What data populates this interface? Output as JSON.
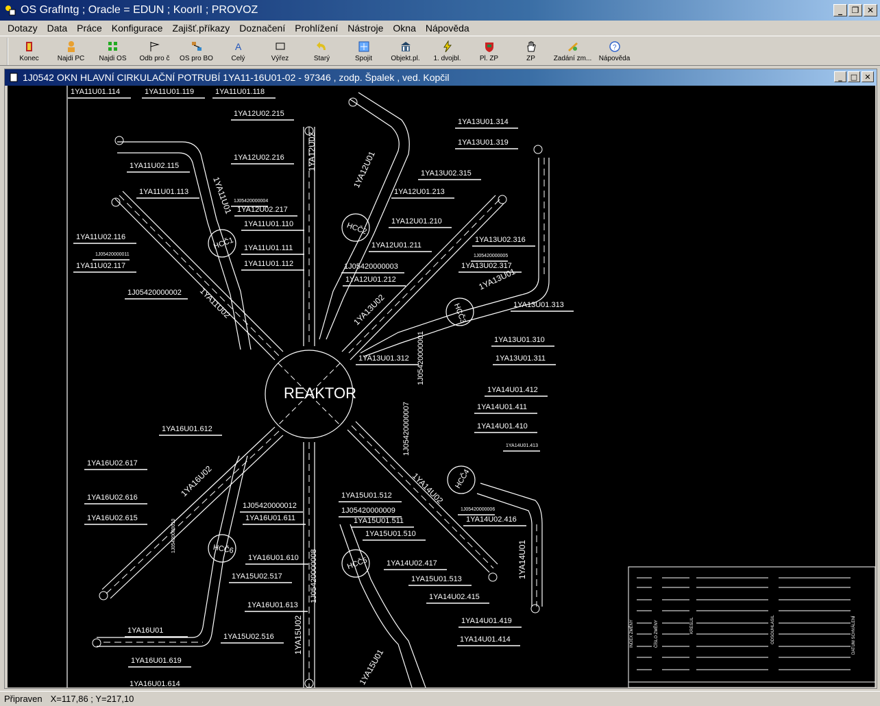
{
  "app": {
    "title": "OS GrafIntg ; Oracle = EDUN ; KoorII ; PROVOZ"
  },
  "menu": [
    "Dotazy",
    "Data",
    "Práce",
    "Konfigurace",
    "Zajišť.příkazy",
    "Doznačení",
    "Prohlížení",
    "Nástroje",
    "Okna",
    "Nápověda"
  ],
  "toolbar": [
    {
      "label": "Konec",
      "icon": "exit-icon"
    },
    {
      "label": "Najdi PC",
      "icon": "find-person-icon"
    },
    {
      "label": "Najdi OS",
      "icon": "find-os-icon"
    },
    {
      "label": "Odb pro č",
      "icon": "flag-icon"
    },
    {
      "label": "OS pro BO",
      "icon": "network-icon"
    },
    {
      "label": "Celý",
      "icon": "text-a-icon"
    },
    {
      "label": "Výřez",
      "icon": "rectangle-icon"
    },
    {
      "label": "Starý",
      "icon": "undo-arrow-icon"
    },
    {
      "label": "Spojit",
      "icon": "join-icon"
    },
    {
      "label": "Objekt.pl.",
      "icon": "building-icon"
    },
    {
      "label": "1. dvojbl.",
      "icon": "lightning-icon"
    },
    {
      "label": "Pl. ZP",
      "icon": "shield-icon"
    },
    {
      "label": "ZP",
      "icon": "hand-icon"
    },
    {
      "label": "Zadání zm...",
      "icon": "edit-icon"
    },
    {
      "label": "Nápověda",
      "icon": "help-icon"
    }
  ],
  "child_window": {
    "title": "1J0542 OKN HLAVNÍ CIRKULAČNÍ POTRUBÍ 1YA11-16U01-02 - 97346 , zodp. Špalek , ved. Kopčil"
  },
  "drawing": {
    "reactor": "REAKTOR",
    "pumps": [
      "HCČ1",
      "HCČ2",
      "HCČ3",
      "HCČ4",
      "HCČ5",
      "HCČ6"
    ],
    "labels": [
      "1YA11U01.114",
      "1YA11U01.119",
      "1YA11U01.118",
      "1YA12U02.215",
      "1YA12U02.216",
      "1YA11U02.115",
      "1YA11U01.113",
      "1J05420000004",
      "1YA12U02.217",
      "1YA11U01.110",
      "1YA11U01.111",
      "1YA11U01.112",
      "1YA11U02.116",
      "1J05420000011",
      "1YA11U02.117",
      "1J05420000002",
      "1YA13U01.314",
      "1YA13U01.319",
      "1YA13U02.315",
      "1YA12U01.213",
      "1YA12U01.210",
      "1YA12U01.211",
      "1J05420000003",
      "1YA12U01.212",
      "1YA13U02.316",
      "1J05420000005",
      "1YA13U02.317",
      "1YA13U01.313",
      "1YA13U01.310",
      "1YA13U01.311",
      "1YA13U01.312",
      "1J05420000001",
      "1YA14U01.412",
      "1YA14U01.411",
      "1YA14U01.410",
      "1YA14U01.413",
      "1J05420000007",
      "1J05420000006",
      "1YA14U02.416",
      "1YA16U01.612",
      "1YA16U02.617",
      "1YA16U02.616",
      "1YA16U02.615",
      "1J05420000010",
      "1J05420000012",
      "1YA16U01.611",
      "1YA15U01.512",
      "1J05420000009",
      "1YA15U01.511",
      "1YA15U01.510",
      "1YA16U01.610",
      "1YA15U02.517",
      "1YA14U02.417",
      "1YA15U01.513",
      "1YA14U02.415",
      "1YA16U01.613",
      "1J05420000008",
      "1YA15U02.516",
      "1YA16U01",
      "1YA16U01.619",
      "1YA16U01.614",
      "1YA14U01.419",
      "1YA14U01.414"
    ],
    "pipe_names": [
      "1YA11U01",
      "1YA12U02",
      "1YA12U01",
      "1YA13U01",
      "1YA13U02",
      "1YA11U02",
      "1YA14U02",
      "1YA14U01",
      "1YA16U02",
      "1YA15U02",
      "1YA15U01"
    ],
    "title_block_headers": [
      "INDEX ZMĚNY",
      "ČÍSLO ZMĚNY",
      "KRESLIL",
      "ODSOUHLASIL",
      "DATUM SCHVÁLENÍ"
    ]
  },
  "status": {
    "state": "Připraven",
    "coords": "X=117,86 ; Y=217,10"
  }
}
